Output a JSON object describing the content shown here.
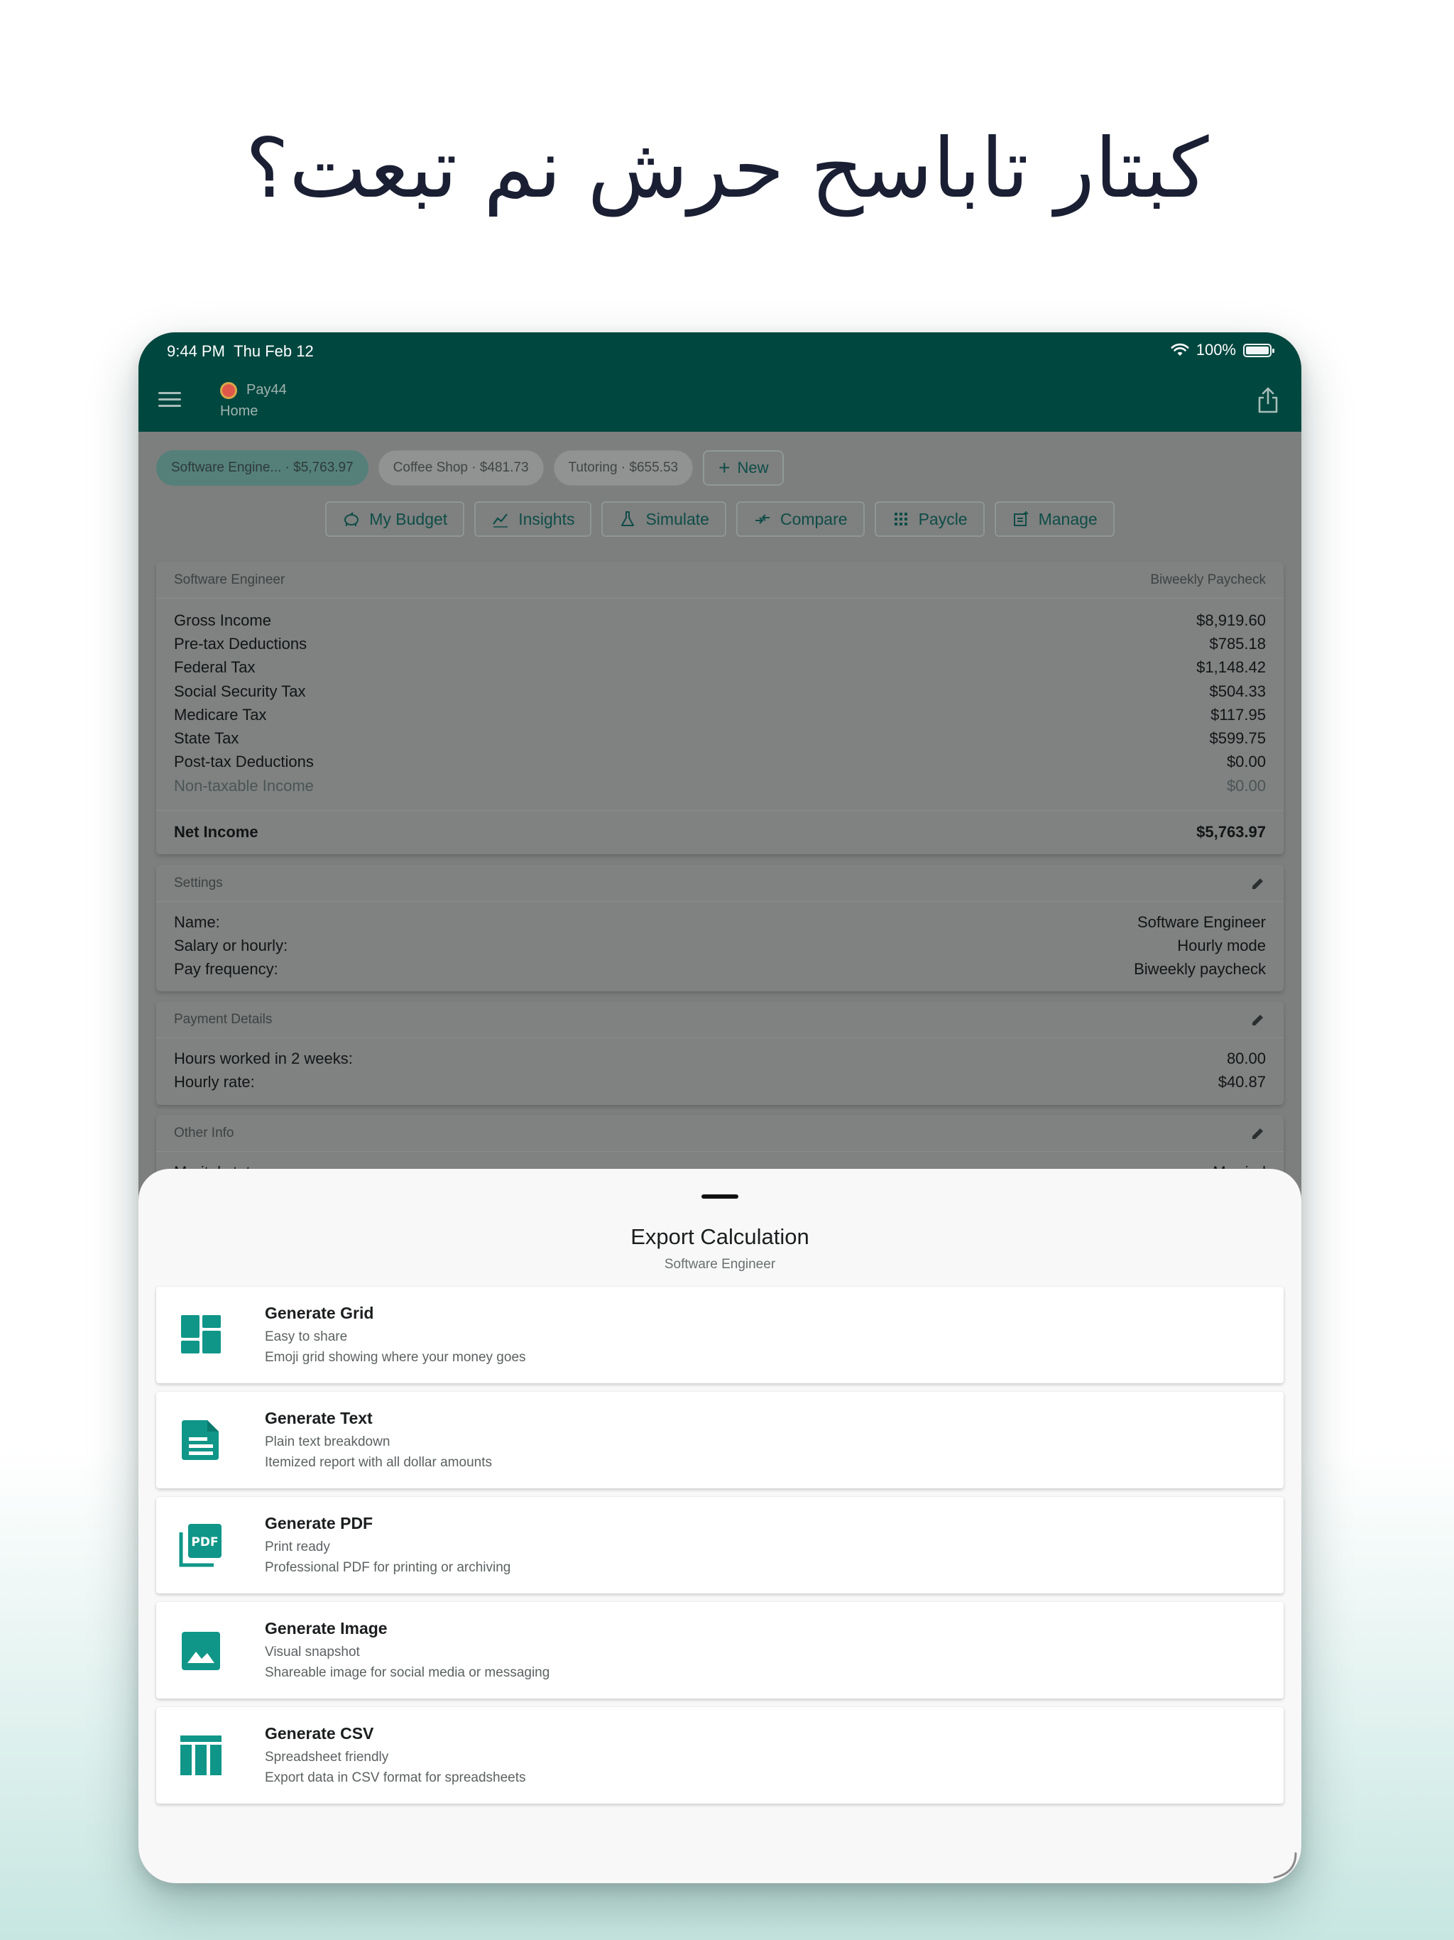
{
  "headline": "كبتار تاباسح حرش نم تبعت؟",
  "status": {
    "time": "9:44 PM",
    "date": "Thu Feb 12",
    "battery": "100%"
  },
  "appbar": {
    "app_name": "Pay44",
    "page": "Home"
  },
  "chips": [
    {
      "label": "Software Engine... · $5,763.97",
      "selected": true
    },
    {
      "label": "Coffee Shop · $481.73",
      "selected": false
    },
    {
      "label": "Tutoring · $655.53",
      "selected": false
    }
  ],
  "new_chip": "New",
  "actions": [
    {
      "label": "My Budget",
      "icon": "piggy-bank-icon"
    },
    {
      "label": "Insights",
      "icon": "trend-icon"
    },
    {
      "label": "Simulate",
      "icon": "flask-icon"
    },
    {
      "label": "Compare",
      "icon": "compare-arrows-icon"
    },
    {
      "label": "Paycle",
      "icon": "grid-icon"
    },
    {
      "label": "Manage",
      "icon": "manage-icon"
    }
  ],
  "summary": {
    "title": "Software Engineer",
    "period": "Biweekly Paycheck",
    "rows": [
      {
        "label": "Gross Income",
        "value": "$8,919.60"
      },
      {
        "label": "Pre-tax Deductions",
        "value": "$785.18"
      },
      {
        "label": "Federal Tax",
        "value": "$1,148.42"
      },
      {
        "label": "Social Security Tax",
        "value": "$504.33"
      },
      {
        "label": "Medicare Tax",
        "value": "$117.95"
      },
      {
        "label": "State Tax",
        "value": "$599.75"
      },
      {
        "label": "Post-tax Deductions",
        "value": "$0.00"
      },
      {
        "label": "Non-taxable Income",
        "value": "$0.00"
      }
    ],
    "total_label": "Net Income",
    "total_value": "$5,763.97"
  },
  "settings": {
    "title": "Settings",
    "rows": [
      {
        "label": "Name:",
        "value": "Software Engineer"
      },
      {
        "label": "Salary or hourly:",
        "value": "Hourly mode"
      },
      {
        "label": "Pay frequency:",
        "value": "Biweekly paycheck"
      }
    ]
  },
  "payment": {
    "title": "Payment Details",
    "rows": [
      {
        "label": "Hours worked in 2 weeks:",
        "value": "80.00"
      },
      {
        "label": "Hourly rate:",
        "value": "$40.87"
      }
    ]
  },
  "other": {
    "title": "Other Info",
    "rows": [
      {
        "label": "Marital status:",
        "value": "Married"
      }
    ]
  },
  "sheet": {
    "title": "Export Calculation",
    "subtitle": "Software Engineer",
    "options": [
      {
        "title": "Generate Grid",
        "line1": "Easy to share",
        "line2": "Emoji grid showing where your money goes",
        "icon": "grid-layout-icon"
      },
      {
        "title": "Generate Text",
        "line1": "Plain text breakdown",
        "line2": "Itemized report with all dollar amounts",
        "icon": "text-document-icon"
      },
      {
        "title": "Generate PDF",
        "line1": "Print ready",
        "line2": "Professional PDF for printing or archiving",
        "icon": "pdf-icon"
      },
      {
        "title": "Generate Image",
        "line1": "Visual snapshot",
        "line2": "Shareable image for social media or messaging",
        "icon": "image-icon"
      },
      {
        "title": "Generate CSV",
        "line1": "Spreadsheet friendly",
        "line2": "Export data in CSV format for spreadsheets",
        "icon": "table-icon"
      }
    ]
  },
  "colors": {
    "brand": "#00473f",
    "accent": "#0f9688",
    "scrim": "#7d7e7e"
  }
}
